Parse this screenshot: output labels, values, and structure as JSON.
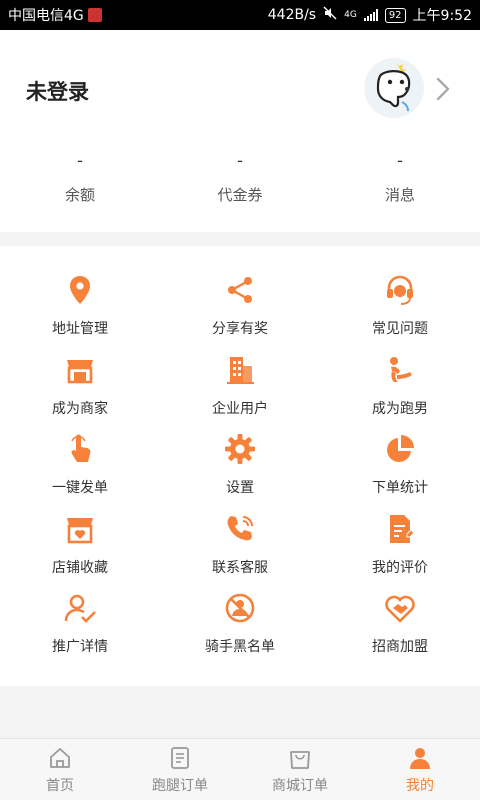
{
  "colors": {
    "accent": "#f5813a",
    "text": "#333333",
    "muted": "#888888"
  },
  "status_bar": {
    "carrier": "中国电信4G",
    "speed": "442B/s",
    "network": "4G",
    "battery": "92",
    "time": "上午9:52"
  },
  "profile": {
    "login_text": "未登录",
    "stats": [
      {
        "value": "-",
        "label": "余额"
      },
      {
        "value": "-",
        "label": "代金券"
      },
      {
        "value": "-",
        "label": "消息"
      }
    ]
  },
  "menu": {
    "items": [
      {
        "label": "地址管理",
        "icon": "location-pin-icon"
      },
      {
        "label": "分享有奖",
        "icon": "share-icon"
      },
      {
        "label": "常见问题",
        "icon": "headset-icon"
      },
      {
        "label": "成为商家",
        "icon": "storefront-icon"
      },
      {
        "label": "企业用户",
        "icon": "building-icon"
      },
      {
        "label": "成为跑男",
        "icon": "runner-icon"
      },
      {
        "label": "一键发单",
        "icon": "tap-finger-icon"
      },
      {
        "label": "设置",
        "icon": "gear-icon"
      },
      {
        "label": "下单统计",
        "icon": "pie-chart-icon"
      },
      {
        "label": "店铺收藏",
        "icon": "store-heart-icon"
      },
      {
        "label": "联系客服",
        "icon": "phone-icon"
      },
      {
        "label": "我的评价",
        "icon": "document-edit-icon"
      },
      {
        "label": "推广详情",
        "icon": "user-check-icon"
      },
      {
        "label": "骑手黑名单",
        "icon": "blocked-user-icon"
      },
      {
        "label": "招商加盟",
        "icon": "handshake-heart-icon"
      }
    ]
  },
  "bottom_nav": {
    "tabs": [
      {
        "label": "首页",
        "icon": "home-icon"
      },
      {
        "label": "跑腿订单",
        "icon": "order-list-icon"
      },
      {
        "label": "商城订单",
        "icon": "shopping-bag-icon"
      },
      {
        "label": "我的",
        "icon": "profile-icon",
        "active": true
      }
    ]
  }
}
